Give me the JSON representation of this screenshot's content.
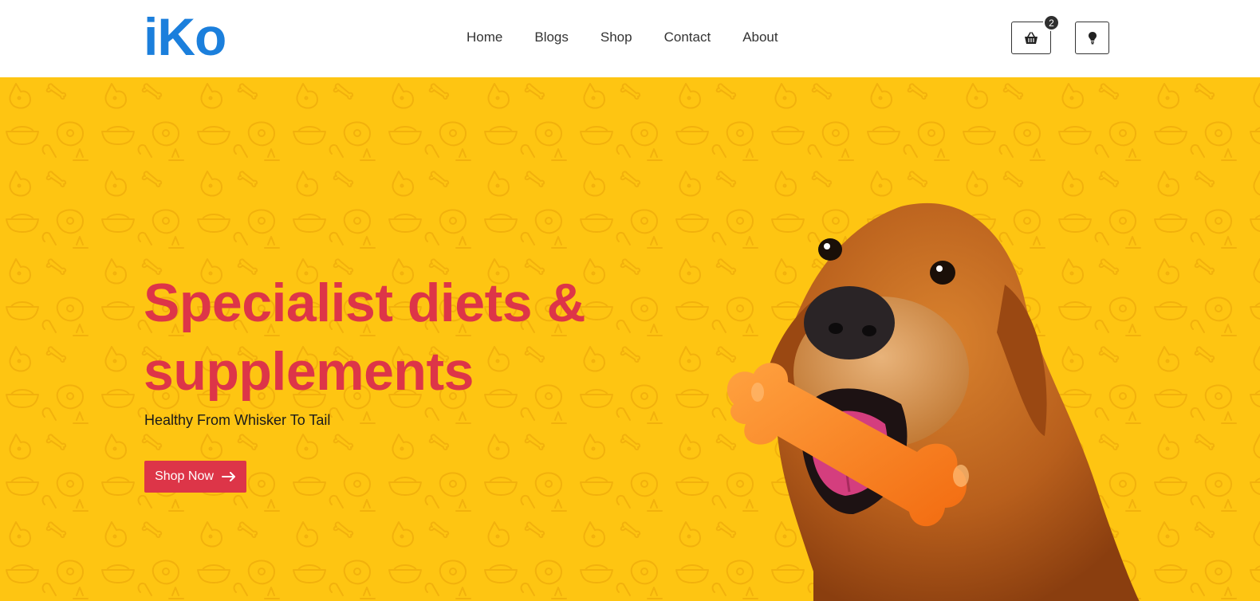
{
  "header": {
    "logo": "iKo",
    "nav": [
      {
        "label": "Home"
      },
      {
        "label": "Blogs"
      },
      {
        "label": "Shop"
      },
      {
        "label": "Contact"
      },
      {
        "label": "About"
      }
    ],
    "cart_count": "2",
    "icons": {
      "cart": "basket-icon",
      "idea": "lightbulb-icon"
    }
  },
  "hero": {
    "title": "Specialist diets & supplements",
    "subtitle": "Healthy From Whisker To Tail",
    "cta_label": "Shop Now",
    "cta_icon": "arrow-right-icon"
  },
  "colors": {
    "brand_blue": "#1b7fdc",
    "hero_background": "#fec512",
    "accent_red": "#dd3548",
    "nav_text": "#333333"
  }
}
